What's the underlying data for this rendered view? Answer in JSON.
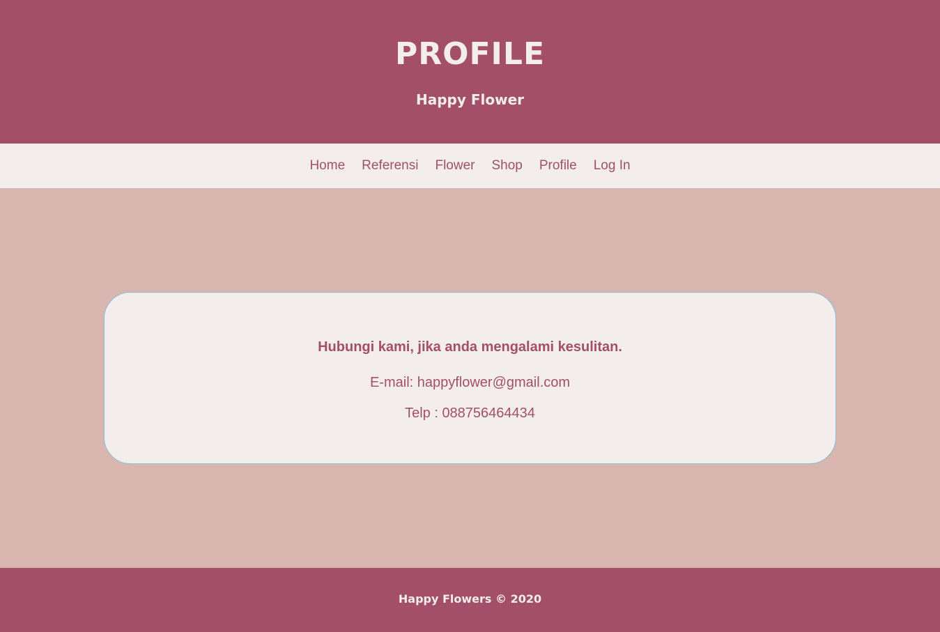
{
  "header": {
    "title": "PROFILE",
    "subtitle": "Happy Flower"
  },
  "nav": {
    "items": [
      {
        "label": "Home"
      },
      {
        "label": "Referensi"
      },
      {
        "label": "Flower"
      },
      {
        "label": "Shop"
      },
      {
        "label": "Profile"
      },
      {
        "label": "Log In"
      }
    ]
  },
  "contact": {
    "heading": "Hubungi kami, jika anda mengalami kesulitan.",
    "email": "E-mail: happyflower@gmail.com",
    "phone": "Telp : 088756464434"
  },
  "footer": {
    "copyright": "Happy Flowers © 2020"
  },
  "colors": {
    "primary": "#a34f69",
    "background": "#d9b5af",
    "surface": "#f3eeeb",
    "card_border": "#86c0d2"
  }
}
